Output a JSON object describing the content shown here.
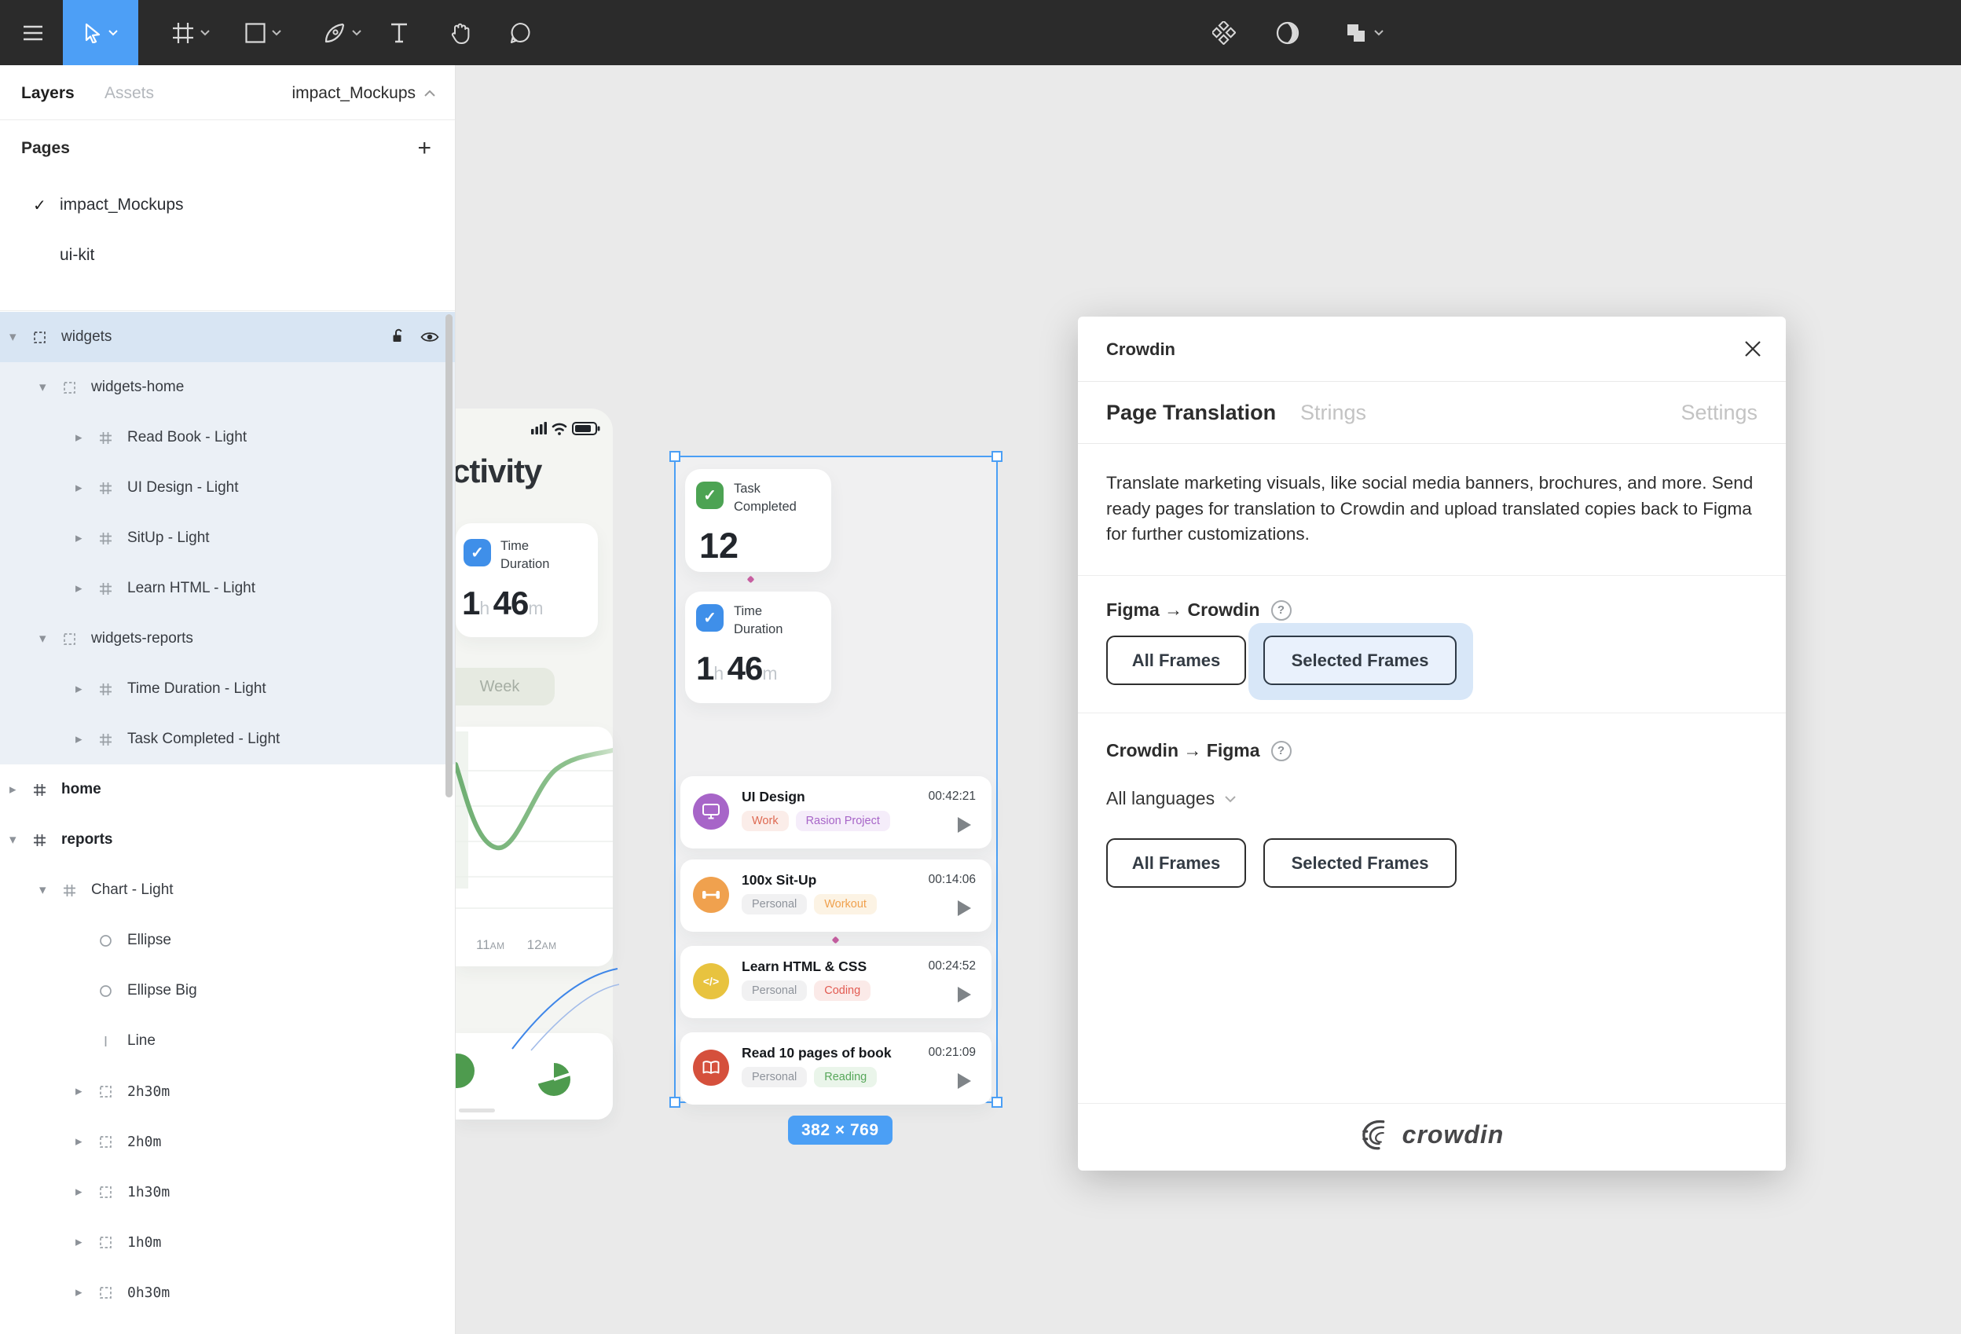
{
  "toolbar": {
    "tools": [
      {
        "name": "main-menu"
      },
      {
        "name": "move-tool",
        "selected": true,
        "dropdown": true
      },
      {
        "name": "frame-tool",
        "dropdown": true
      },
      {
        "name": "shape-tool",
        "dropdown": true
      },
      {
        "name": "pen-tool",
        "dropdown": true
      },
      {
        "name": "text-tool"
      },
      {
        "name": "hand-tool"
      },
      {
        "name": "comment-tool"
      }
    ],
    "right_tools": [
      {
        "name": "component-tool"
      },
      {
        "name": "mask-tool"
      },
      {
        "name": "boolean-tool",
        "dropdown": true
      }
    ]
  },
  "sidebar": {
    "tabs": [
      {
        "label": "Layers",
        "active": true
      },
      {
        "label": "Assets",
        "active": false
      }
    ],
    "file_menu": {
      "label": "impact_Mockups"
    },
    "pages": {
      "header": "Pages",
      "add_label": "+",
      "items": [
        {
          "label": "impact_Mockups",
          "current": true
        },
        {
          "label": "ui-kit",
          "current": false
        }
      ]
    },
    "tree": [
      {
        "label": "widgets",
        "icon": "group",
        "depth": 0,
        "arrow": "open",
        "selected": true,
        "lock": true,
        "eye": true
      },
      {
        "label": "widgets-home",
        "icon": "group",
        "depth": 1,
        "arrow": "open",
        "tint": true
      },
      {
        "label": "Read Book - Light",
        "icon": "frame",
        "depth": 2,
        "arrow": "closed",
        "tint": true
      },
      {
        "label": "UI Design - Light",
        "icon": "frame",
        "depth": 2,
        "arrow": "closed",
        "tint": true
      },
      {
        "label": "SitUp - Light",
        "icon": "frame",
        "depth": 2,
        "arrow": "closed",
        "tint": true
      },
      {
        "label": "Learn HTML - Light",
        "icon": "frame",
        "depth": 2,
        "arrow": "closed",
        "tint": true
      },
      {
        "label": "widgets-reports",
        "icon": "group",
        "depth": 1,
        "arrow": "open",
        "tint": true
      },
      {
        "label": "Time Duration - Light",
        "icon": "frame",
        "depth": 2,
        "arrow": "closed",
        "tint": true
      },
      {
        "label": "Task Completed - Light",
        "icon": "frame",
        "depth": 2,
        "arrow": "closed",
        "tint": true
      },
      {
        "label": "home",
        "icon": "frame",
        "depth": 0,
        "arrow": "closed",
        "bold": true
      },
      {
        "label": "reports",
        "icon": "frame",
        "depth": 0,
        "arrow": "open",
        "bold": true
      },
      {
        "label": "Chart - Light",
        "icon": "frame",
        "depth": 1,
        "arrow": "open"
      },
      {
        "label": "Ellipse",
        "icon": "ellipse",
        "depth": 2
      },
      {
        "label": "Ellipse Big",
        "icon": "ellipse",
        "depth": 2
      },
      {
        "label": "Line",
        "icon": "line",
        "depth": 2
      },
      {
        "label": "2h30m",
        "icon": "group",
        "depth": 2,
        "arrow": "closed",
        "mono": true
      },
      {
        "label": "2h0m",
        "icon": "group",
        "depth": 2,
        "arrow": "closed",
        "mono": true
      },
      {
        "label": "1h30m",
        "icon": "group",
        "depth": 2,
        "arrow": "closed",
        "mono": true
      },
      {
        "label": "1h0m",
        "icon": "group",
        "depth": 2,
        "arrow": "closed",
        "mono": true
      },
      {
        "label": "0h30m",
        "icon": "group",
        "depth": 2,
        "arrow": "closed",
        "mono": true
      }
    ]
  },
  "canvas": {
    "left_mockup": {
      "title": "ctivity",
      "duration_card": {
        "label": "Time Duration",
        "hours": "1",
        "h_unit": "h",
        "minutes": "46",
        "m_unit": "m"
      },
      "week_pill": "Week",
      "x_labels": [
        {
          "num": "11",
          "suffix": "AM"
        },
        {
          "num": "12",
          "suffix": "AM"
        }
      ]
    },
    "selected_frame": {
      "task_completed_card": {
        "label": "Task Completed",
        "value": "12"
      },
      "duration_card": {
        "label": "Time Duration",
        "hours": "1",
        "h_unit": "h",
        "minutes": "46",
        "m_unit": "m"
      },
      "tasks": [
        {
          "title": "UI Design",
          "time": "00:42:21",
          "icon": "monitor",
          "icon_color": "#A765C8",
          "tags": [
            {
              "label": "Work",
              "fg": "#DE6A52",
              "bg": "#FBEDE9"
            },
            {
              "label": "Rasion Project",
              "fg": "#A765C8",
              "bg": "#F5EDFA"
            }
          ]
        },
        {
          "title": "100x Sit-Up",
          "time": "00:14:06",
          "icon": "dumbbell",
          "icon_color": "#F0A14E",
          "tags": [
            {
              "label": "Personal",
              "fg": "#8E939B",
              "bg": "#F1F1F2"
            },
            {
              "label": "Workout",
              "fg": "#F0A14E",
              "bg": "#FCF3E4"
            }
          ]
        },
        {
          "title": "Learn HTML & CSS",
          "time": "00:24:52",
          "icon": "code",
          "icon_color": "#E8C33F",
          "tags": [
            {
              "label": "Personal",
              "fg": "#8E939B",
              "bg": "#F1F1F2"
            },
            {
              "label": "Coding",
              "fg": "#E25B52",
              "bg": "#FBEAE8"
            }
          ]
        },
        {
          "title": "Read 10 pages of book",
          "time": "00:21:09",
          "icon": "book",
          "icon_color": "#D5503C",
          "tags": [
            {
              "label": "Personal",
              "fg": "#8E939B",
              "bg": "#F1F1F2"
            },
            {
              "label": "Reading",
              "fg": "#57A75A",
              "bg": "#EAF5EA"
            }
          ]
        }
      ]
    },
    "size_badge": "382 × 769"
  },
  "dialog": {
    "title": "Crowdin",
    "tabs": [
      {
        "label": "Page Translation",
        "active": true
      },
      {
        "label": "Strings",
        "active": false
      }
    ],
    "settings_tab": "Settings",
    "description": "Translate marketing visuals, like social media banners, brochures, and more. Send ready pages for translation to Crowdin and upload translated copies back to Figma for further customizations.",
    "figma_to_crowdin": {
      "title": "Figma → Crowdin",
      "buttons": [
        {
          "label": "All Frames",
          "selected": false
        },
        {
          "label": "Selected Frames",
          "selected": true
        }
      ]
    },
    "crowdin_to_figma": {
      "title": "Crowdin → Figma",
      "language_dropdown": "All languages",
      "buttons": [
        {
          "label": "All Frames",
          "selected": false
        },
        {
          "label": "Selected Frames",
          "selected": false
        }
      ]
    },
    "logo_text": "crowdin"
  },
  "colors": {
    "accent_blue": "#4B9FF5",
    "toolbar_bg": "#2B2B2B",
    "canvas_bg": "#EAEAEA",
    "selected_row": "#D8E5F3",
    "tinted_row": "#EBF0F6",
    "halo_blue": "#D8E7F8",
    "green_check": "#4CA353",
    "blue_check": "#3F8FE9"
  }
}
